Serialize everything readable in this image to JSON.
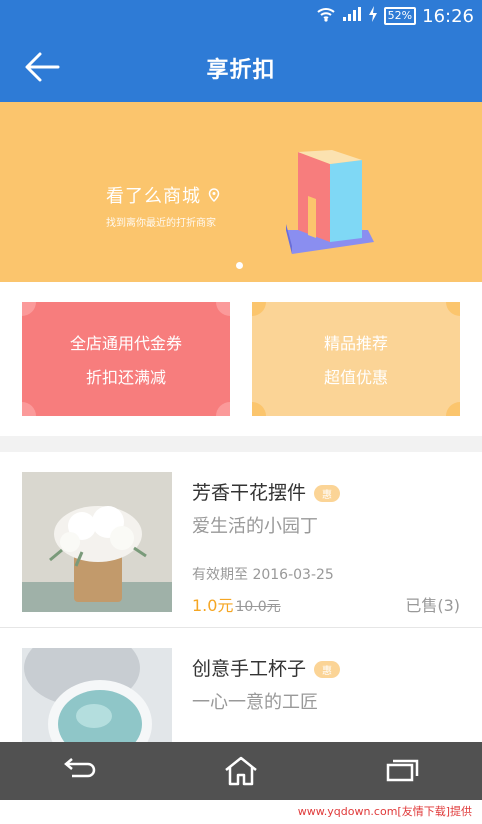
{
  "status": {
    "time": "16:26",
    "battery": "52%"
  },
  "appbar": {
    "title": "享折扣"
  },
  "banner": {
    "title": "看了么商城",
    "subtitle": "找到离你最近的打折商家"
  },
  "promos": [
    {
      "line1": "全店通用代金券",
      "line2": "折扣还满减"
    },
    {
      "line1": "精品推荐",
      "line2": "超值优惠"
    }
  ],
  "items": [
    {
      "name": "芳香干花摆件",
      "badge": "惠",
      "slogan": "爱生活的小园丁",
      "valid": "有效期至 2016-03-25",
      "price": "1.0元",
      "old_price": "10.0元",
      "sold": "已售(3)"
    },
    {
      "name": "创意手工杯子",
      "badge": "惠",
      "slogan": "一心一意的工匠"
    }
  ],
  "footer": "www.yqdown.com[友情下载]提供"
}
